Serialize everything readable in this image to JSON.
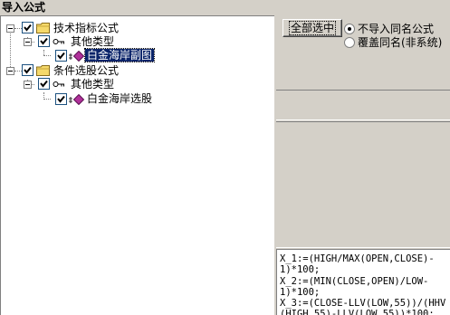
{
  "window": {
    "title": "导入公式"
  },
  "tree": {
    "root1": {
      "label": "技术指标公式",
      "checked": true,
      "expanded": true
    },
    "root1_child": {
      "label": "其他类型",
      "checked": true,
      "expanded": true
    },
    "root1_leaf": {
      "label": "白金海岸副图",
      "checked": true,
      "selected": true
    },
    "root2": {
      "label": "条件选股公式",
      "checked": true,
      "expanded": true
    },
    "root2_child": {
      "label": "其他类型",
      "checked": true,
      "expanded": true
    },
    "root2_leaf": {
      "label": "白金海岸选股",
      "checked": true,
      "selected": false
    }
  },
  "options": {
    "select_all_label": "全部选中",
    "radio1_label": "不导入同名公式",
    "radio1_selected": true,
    "radio2_label": "覆盖同名(非系统)",
    "radio2_selected": false
  },
  "formula_text": "X_1:=(HIGH/MAX(OPEN,CLOSE)-\n1)*100;\nX_2:=(MIN(CLOSE,OPEN)/LOW-\n1)*100;\nX_3:=(CLOSE-LLV(LOW,55))/(HHV\n(HIGH,55)-LLV(LOW,55))*100;",
  "colors": {
    "selection": "#0a246a",
    "face": "#d4d0c8",
    "folder": "#f5d96b",
    "gem": "#b0309a"
  }
}
